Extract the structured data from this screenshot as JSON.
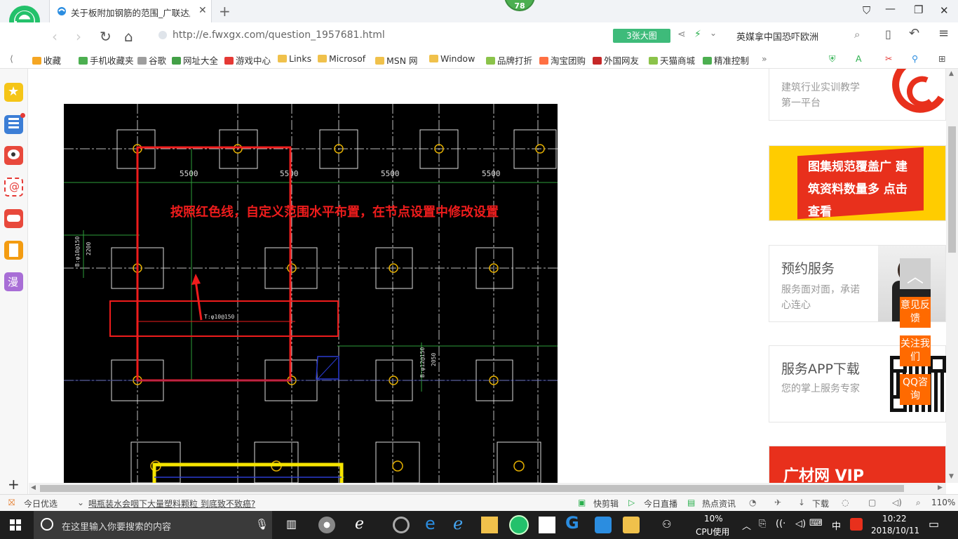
{
  "browser": {
    "tab_title": "关于板附加钢筋的范围_广联达服",
    "badge_count": "78",
    "url": "http://e.fwxgx.com/question_1957681.html",
    "big_image_btn": "3张大图",
    "search_query": "英媒拿中国恐吓欧洲"
  },
  "bookmarks": [
    {
      "label": "收藏",
      "color": "#f5a623"
    },
    {
      "label": "手机收藏夹",
      "color": "#4caf50"
    },
    {
      "label": "谷歌",
      "color": "#9e9e9e"
    },
    {
      "label": "网址大全",
      "color": "#43a047"
    },
    {
      "label": "游戏中心",
      "color": "#e53935"
    },
    {
      "label": "Links",
      "color": "#f0c14b"
    },
    {
      "label": "Microsof",
      "color": "#f0c14b"
    },
    {
      "label": "MSN 网",
      "color": "#f0c14b"
    },
    {
      "label": "Window",
      "color": "#f0c14b"
    },
    {
      "label": "品牌打折",
      "color": "#8bc34a"
    },
    {
      "label": "淘宝团购",
      "color": "#ff7043"
    },
    {
      "label": "外国网友",
      "color": "#c62828"
    },
    {
      "label": "天猫商城",
      "color": "#8bc34a"
    },
    {
      "label": "精准控制",
      "color": "#4caf50"
    }
  ],
  "cad": {
    "annotation": "按照红色线，自定义范围水平布置，在节点设置中修改设置",
    "dims": [
      "5500",
      "5500",
      "5500",
      "5500"
    ],
    "rebar_label": "T:φ10@150",
    "left_label_1": "B:φ10@150",
    "left_label_2": "2200",
    "right_label_1": "B:φ12@150",
    "right_label_2": "2050"
  },
  "right_cards": [
    {
      "title": "",
      "desc": "建筑行业实训教学第一平台"
    },
    {
      "title": "",
      "desc": "图集规范覆盖广 建筑资料数量多 点击查看"
    },
    {
      "title": "预约服务",
      "desc": "服务面对面，承诺心连心"
    },
    {
      "title": "服务APP下载",
      "desc": "您的掌上服务专家"
    },
    {
      "title": "",
      "desc": "广材网 VIP"
    }
  ],
  "float_buttons": [
    "意见反馈",
    "关注我们",
    "QQ咨询"
  ],
  "statusbar": {
    "left_label": "今日优选",
    "news": "喝瓶装水会咽下大量塑料颗粒 到底致不致癌?",
    "items": [
      "快剪辑",
      "今日直播",
      "热点资讯",
      "下载"
    ],
    "zoom": "110%"
  },
  "taskbar": {
    "search_placeholder": "在这里输入你要搜索的内容",
    "cpu_percent": "10%",
    "cpu_label": "CPU使用",
    "ime": "中",
    "time": "10:22",
    "date": "2018/10/11"
  }
}
